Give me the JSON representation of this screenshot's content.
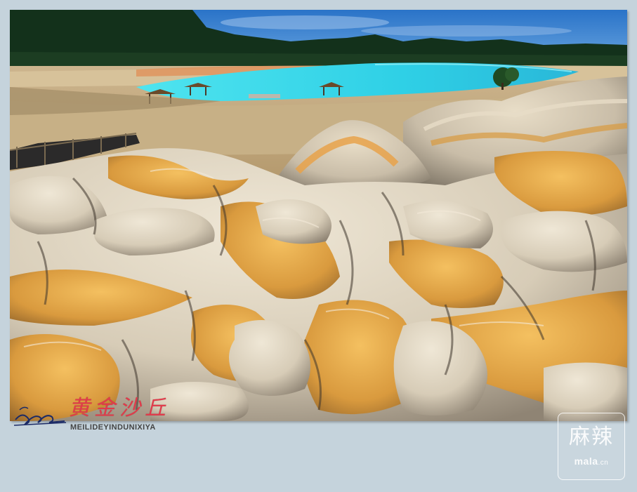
{
  "photo": {
    "subject": "eroded-rock-landscape-with-turquoise-lake",
    "colors": {
      "sky": "#2f7fd0",
      "lake": "#38d8ea",
      "forest": "#14301a",
      "rock_light": "#d6d0c3",
      "rock_ochre": "#e0a040"
    }
  },
  "caption": {
    "title_cn": "黄金沙丘",
    "subtitle": "MEILIDEYINDUNIXIYA"
  },
  "watermark": {
    "text_cn": "麻辣",
    "domain_main": "mala",
    "domain_suffix": ".cn"
  }
}
